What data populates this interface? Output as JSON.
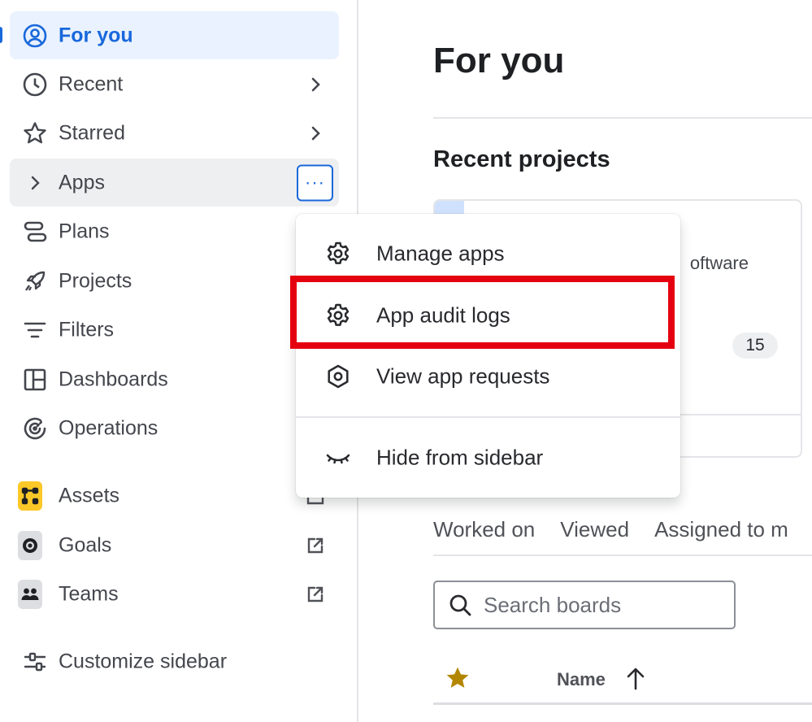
{
  "sidebar": {
    "items": [
      {
        "label": "For you",
        "icon": "person-circle-icon"
      },
      {
        "label": "Recent",
        "icon": "clock-icon"
      },
      {
        "label": "Starred",
        "icon": "star-icon"
      },
      {
        "label": "Apps",
        "icon": "chevron-right-icon",
        "more": "···"
      },
      {
        "label": "Plans",
        "icon": "plans-icon"
      },
      {
        "label": "Projects",
        "icon": "rocket-icon"
      },
      {
        "label": "Filters",
        "icon": "filter-icon"
      },
      {
        "label": "Dashboards",
        "icon": "dashboard-icon"
      },
      {
        "label": "Operations",
        "icon": "operations-icon"
      },
      {
        "label": "Assets",
        "icon": "assets-icon"
      },
      {
        "label": "Goals",
        "icon": "goals-icon"
      },
      {
        "label": "Teams",
        "icon": "teams-icon"
      },
      {
        "label": "Customize sidebar",
        "icon": "customize-icon"
      }
    ]
  },
  "main": {
    "title": "For you",
    "recent_projects_title": "Recent projects",
    "project_card": {
      "subtitle_fragment": "oftware",
      "count": "15"
    },
    "tabs": [
      "Worked on",
      "Viewed",
      "Assigned to m"
    ],
    "search": {
      "placeholder": "Search boards",
      "value": ""
    },
    "table": {
      "name_header": "Name"
    }
  },
  "menu": {
    "items": [
      {
        "label": "Manage apps",
        "icon": "gear-icon"
      },
      {
        "label": "App audit logs",
        "icon": "gear-icon"
      },
      {
        "label": "View app requests",
        "icon": "hexagon-icon"
      },
      {
        "label": "Hide from sidebar",
        "icon": "eye-closed-icon"
      }
    ]
  },
  "colors": {
    "accent": "#1868db",
    "highlight": "#e5000f",
    "star": "#b38600",
    "assets_tile": "#fbc828"
  }
}
